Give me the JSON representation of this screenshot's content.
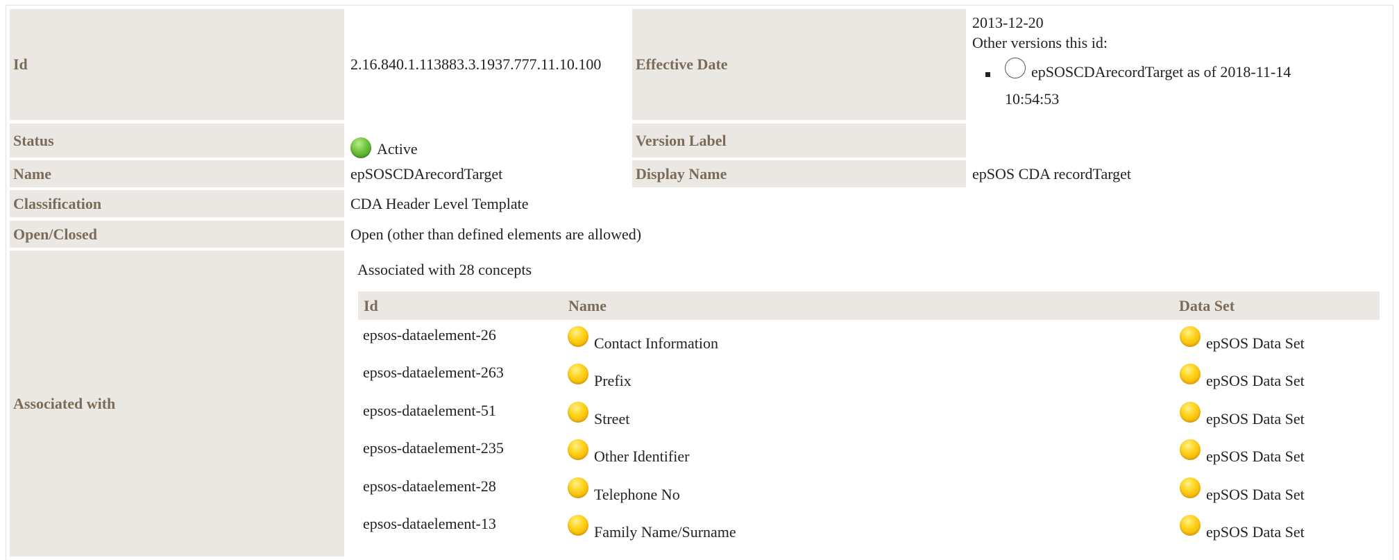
{
  "fields": {
    "id_label": "Id",
    "id_value": "2.16.840.1.113883.3.1937.777.11.10.100",
    "effective_date_label": "Effective Date",
    "effective_date_value": "2013-12-20",
    "other_versions_label": "Other versions this id:",
    "other_version_item_line1": "epSOSCDArecordTarget as of 2018-11-14",
    "other_version_item_line2": "10:54:53",
    "status_label": "Status",
    "status_value": "Active",
    "version_label_label": "Version Label",
    "version_label_value": "",
    "name_label": "Name",
    "name_value": "epSOSCDArecordTarget",
    "display_name_label": "Display Name",
    "display_name_value": "epSOS CDA recordTarget",
    "classification_label": "Classification",
    "classification_value": "CDA Header Level Template",
    "open_closed_label": "Open/Closed",
    "open_closed_value": "Open (other than defined elements are allowed)",
    "associated_label": "Associated with"
  },
  "associations": {
    "summary": "Associated with 28 concepts",
    "headers": {
      "id": "Id",
      "name": "Name",
      "dataset": "Data Set"
    },
    "rows": [
      {
        "id": "epsos-dataelement-26",
        "name": "Contact Information",
        "dataset": "epSOS Data Set"
      },
      {
        "id": "epsos-dataelement-263",
        "name": "Prefix",
        "dataset": "epSOS Data Set"
      },
      {
        "id": "epsos-dataelement-51",
        "name": "Street",
        "dataset": "epSOS Data Set"
      },
      {
        "id": "epsos-dataelement-235",
        "name": "Other Identifier",
        "dataset": "epSOS Data Set"
      },
      {
        "id": "epsos-dataelement-28",
        "name": "Telephone No",
        "dataset": "epSOS Data Set"
      },
      {
        "id": "epsos-dataelement-13",
        "name": "Family Name/Surname",
        "dataset": "epSOS Data Set"
      }
    ]
  },
  "colors": {
    "label_bg": "#ebe8e3",
    "label_text": "#7a6b5a",
    "status_active": "#5cb832",
    "concept_status": "#ffc800"
  }
}
